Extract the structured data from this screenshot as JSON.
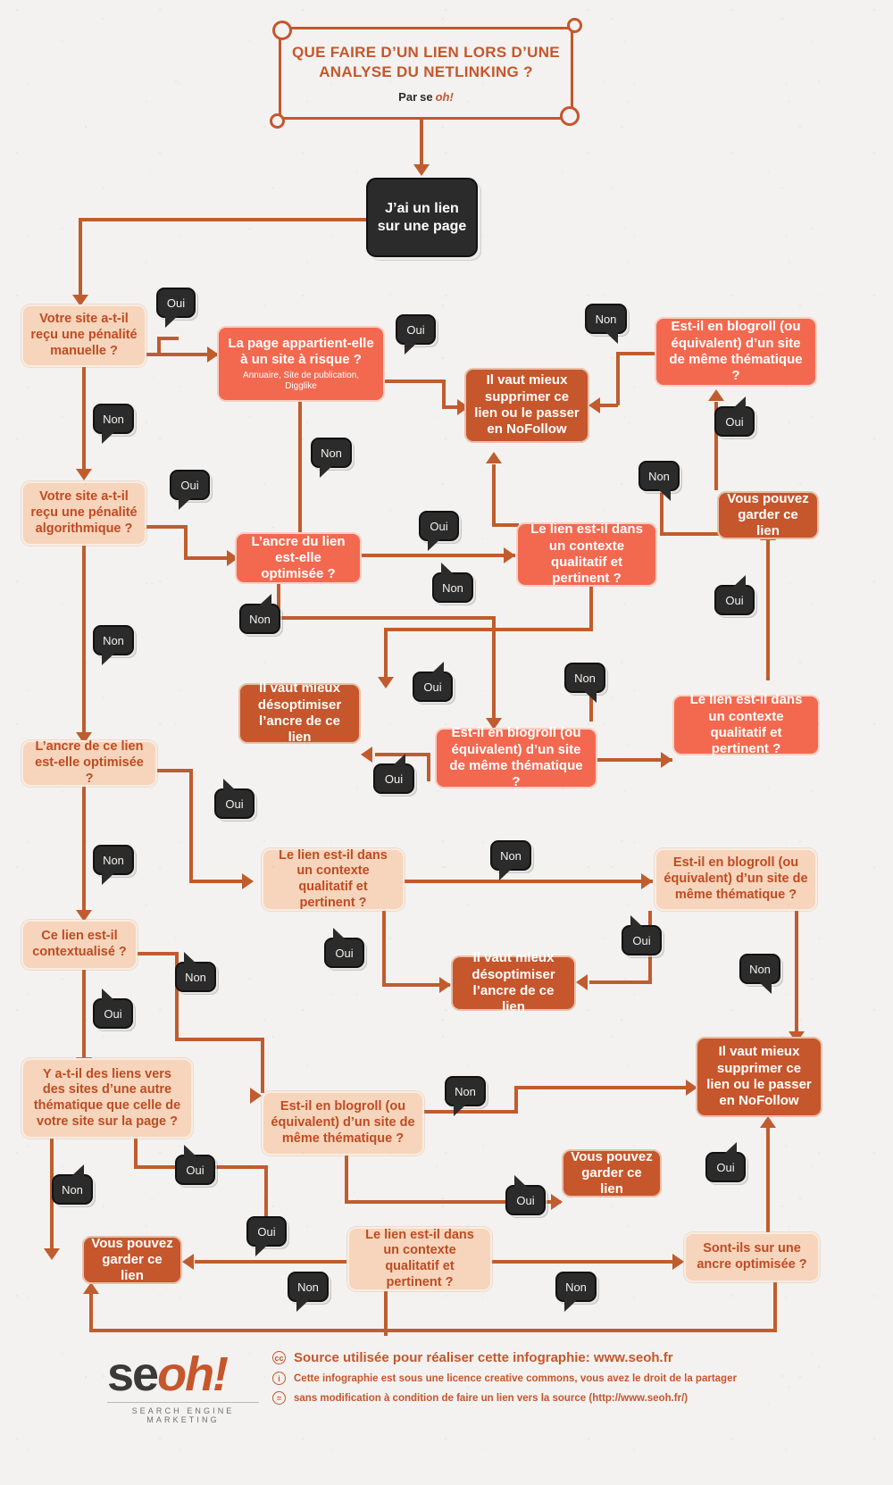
{
  "title": {
    "heading": "QUE FAIRE D’UN LIEN LORS D’UNE ANALYSE DU NETLINKING ?",
    "by_prefix": "Par",
    "brand_se": "se",
    "brand_oh": "oh!"
  },
  "start_node": {
    "label": "J’ai un lien\nsur une page"
  },
  "labels": {
    "oui": "Oui",
    "non": "Non"
  },
  "nodes": {
    "penalite_manuelle": {
      "label": "Votre site a-t-il reçu une pénalité manuelle ?",
      "type": "question-peach"
    },
    "page_risque": {
      "label": "La page appartient-elle à un site à risque ?",
      "sub": "Annuaire, Site de publication, Digglike",
      "type": "question-salmon"
    },
    "supprimer_1": {
      "label": "Il vaut mieux supprimer ce lien ou le passer en NoFollow",
      "type": "result-rust"
    },
    "blogroll_1": {
      "label": "Est-il en blogroll (ou équivalent) d’un site de même thématique ?",
      "type": "question-salmon"
    },
    "penalite_algo": {
      "label": "Votre site a-t-il reçu une pénalité algorithmique ?",
      "type": "question-peach"
    },
    "ancre_optimisee_1": {
      "label": "L’ancre du lien est-elle optimisée ?",
      "type": "question-salmon"
    },
    "contexte_1": {
      "label": "Le lien est-il dans un contexte qualitatif et pertinent ?",
      "type": "question-salmon"
    },
    "garder_1": {
      "label": "Vous pouvez garder ce lien",
      "type": "result-rust"
    },
    "desoptimiser_1": {
      "label": "Il vaut mieux désoptimiser l’ancre de ce lien",
      "type": "result-rust"
    },
    "blogroll_2": {
      "label": "Est-il en blogroll (ou équivalent) d’un site de même thématique ?",
      "type": "question-salmon"
    },
    "contexte_2": {
      "label": "Le lien est-il dans un contexte qualitatif et pertinent ?",
      "type": "question-salmon"
    },
    "ancre_ce_lien": {
      "label": "L’ancre de ce lien est-elle optimisée ?",
      "type": "question-peach"
    },
    "contexte_3": {
      "label": "Le lien est-il dans un contexte qualitatif et pertinent ?",
      "type": "question-peach"
    },
    "blogroll_3": {
      "label": "Est-il en blogroll (ou équivalent) d’un site de même thématique ?",
      "type": "question-peach"
    },
    "contextualise": {
      "label": "Ce lien est-il contextualisé ?",
      "type": "question-peach"
    },
    "desoptimiser_2": {
      "label": "Il vaut mieux désoptimiser l’ancre de ce lien",
      "type": "result-rust"
    },
    "liens_autre_thema": {
      "label": "Y a-t-il des liens vers des sites d’une autre thématique que celle de votre site sur la page ?",
      "type": "question-peach"
    },
    "blogroll_4": {
      "label": "Est-il en blogroll (ou équivalent) d’un site de même thématique ?",
      "type": "question-peach"
    },
    "supprimer_2": {
      "label": "Il vaut mieux supprimer ce lien ou le passer en NoFollow",
      "type": "result-rust"
    },
    "garder_2": {
      "label": "Vous pouvez garder ce lien",
      "type": "result-rust"
    },
    "garder_3": {
      "label": "Vous pouvez garder ce lien",
      "type": "result-rust"
    },
    "contexte_4": {
      "label": "Le lien est-il dans un contexte qualitatif et pertinent ?",
      "type": "question-peach"
    },
    "ancre_optimisee_2": {
      "label": "Sont-ils sur une ancre optimisée ?",
      "type": "question-peach"
    }
  },
  "footer": {
    "logo_se": "se",
    "logo_oh": "oh!",
    "logo_tagline": "SEARCH ENGINE MARKETING",
    "credit_icon_1": "cc",
    "credit_icon_2": "i",
    "credit_icon_3": "=",
    "credit_line_1": "Source utilisée pour réaliser cette infographie: www.seoh.fr",
    "credit_line_2": "Cette infographie est sous une licence creative commons, vous avez le droit de la partager",
    "credit_line_3": "sans modification à condition de faire un lien vers la source (http://www.seoh.fr/)"
  },
  "colors": {
    "background": "#f3f2f0",
    "line": "#c05c2e",
    "peach_fill": "#f6d5bc",
    "peach_text": "#bf4b22",
    "salmon_fill": "#f26950",
    "rust_fill": "#c6562c",
    "dark_fill": "#2b2b2b"
  }
}
